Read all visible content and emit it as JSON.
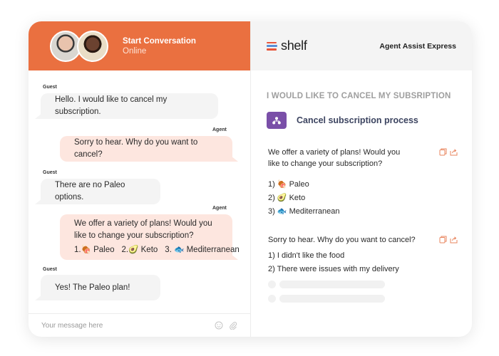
{
  "chat": {
    "header": {
      "title": "Start Conversation",
      "status": "Online",
      "brand_color": "#ea7040"
    },
    "messages": [
      {
        "sender": "Guest",
        "text": "Hello. I would like to cancel my subscription."
      },
      {
        "sender": "Agent",
        "text": "Sorry to hear. Why do you want to cancel?"
      },
      {
        "sender": "Guest",
        "text": "There are no Paleo options."
      },
      {
        "sender": "Agent",
        "text": "We offer a variety of plans! Would you like to change your subscription?",
        "options": [
          {
            "label": "1.🍖 Paleo"
          },
          {
            "label": "2.🥑 Keto"
          },
          {
            "label": "3. 🐟 Mediterranean"
          }
        ]
      },
      {
        "sender": "Guest",
        "text": "Yes! The Paleo plan!"
      }
    ],
    "input": {
      "placeholder": "Your message here",
      "emoji_icon": "smiley-icon",
      "attach_icon": "paperclip-icon"
    }
  },
  "assist": {
    "logo_text": "shelf",
    "title": "Agent Assist Express",
    "query": "I WOULD LIKE TO CANCEL MY SUBSRIPTION",
    "process": {
      "label": "Cancel subscription process",
      "icon": "flow-diagram-icon",
      "icon_color": "#7a4fa8"
    },
    "cards": [
      {
        "text": "We offer a variety of plans! Would you like to change your subscription?",
        "items": [
          "1) 🍖 Paleo",
          "2) 🥑 Keto",
          "3) 🐟 Mediterranean"
        ],
        "actions": [
          "copy-icon",
          "share-icon"
        ]
      },
      {
        "text": "Sorry to hear. Why do you want to cancel?",
        "items": [
          "1)  I didn't like the food",
          "2) There were issues with my delivery"
        ],
        "actions": [
          "copy-icon",
          "share-icon"
        ],
        "loading_placeholders": 2
      }
    ],
    "accent_color": "#e8845e"
  }
}
